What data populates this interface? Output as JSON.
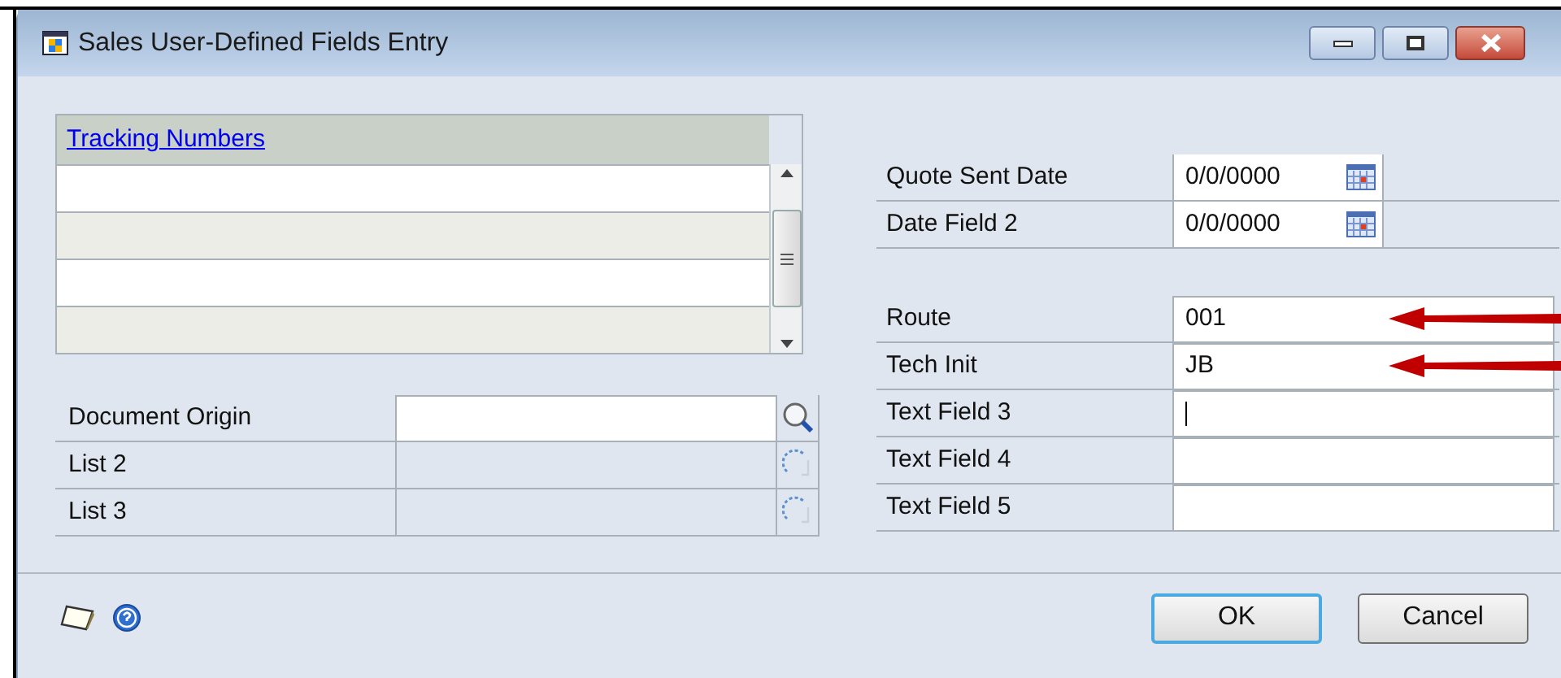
{
  "window": {
    "title": "Sales User-Defined Fields Entry"
  },
  "tracking": {
    "heading": "Tracking Numbers",
    "rows": [
      {
        "shaded": false
      },
      {
        "shaded": true
      },
      {
        "shaded": false
      },
      {
        "shaded": true
      }
    ]
  },
  "lookups": [
    {
      "label": "Document Origin",
      "kind": "search",
      "enabled": true
    },
    {
      "label": "List 2",
      "kind": "list",
      "enabled": false
    },
    {
      "label": "List 3",
      "kind": "list",
      "enabled": false
    }
  ],
  "dates": [
    {
      "label": "Quote Sent Date",
      "value": "0/0/0000"
    },
    {
      "label": "Date Field 2",
      "value": "0/0/0000"
    }
  ],
  "texts": [
    {
      "label": "Route",
      "value": "001",
      "arrow": true,
      "focused": false
    },
    {
      "label": "Tech Init",
      "value": "JB",
      "arrow": true,
      "focused": false
    },
    {
      "label": "Text Field 3",
      "arrow": false,
      "focused": true
    },
    {
      "label": "Text Field 4",
      "arrow": false,
      "focused": false
    },
    {
      "label": "Text Field 5",
      "arrow": false,
      "focused": false
    }
  ],
  "buttons": [
    {
      "label": "OK",
      "default": true
    },
    {
      "label": "Cancel",
      "default": false
    }
  ]
}
